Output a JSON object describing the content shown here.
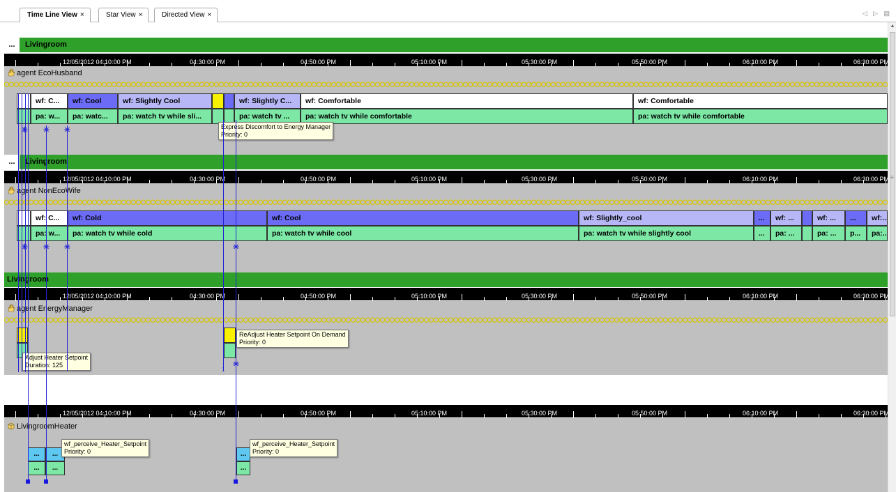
{
  "tabs": [
    {
      "label": "Time Line View",
      "close": "×",
      "active": true
    },
    {
      "label": "Star View",
      "close": "×",
      "active": false
    },
    {
      "label": "Directed View",
      "close": "×",
      "active": false
    }
  ],
  "tab_controls": "◁ ▷ ▤",
  "more_label": "...",
  "timeline": {
    "date_label": "12/05/2012 04:10:00 PM",
    "tick_labels": [
      "04:30:00 PM",
      "04:50:00 PM",
      "05:10:00 PM",
      "05:30:00 PM",
      "05:50:00 PM",
      "06:10:00 PM",
      "06:30:00 PM"
    ]
  },
  "panels": [
    {
      "room": "Livingroom",
      "agent": "agent EcoHusband"
    },
    {
      "room": "Livingroom",
      "agent": "agent NonEcoWife"
    },
    {
      "room": "Livingroom",
      "agent": "agent EnergyManager"
    },
    {
      "room": "",
      "agent": "LivingroomHeater"
    }
  ],
  "husband": {
    "wf": [
      "wf: C...",
      "wf: Cool",
      "wf: Slightly Cool",
      "wf: Slightly C...",
      "wf: Comfortable",
      "wf: Comfortable"
    ],
    "pa": [
      "pa: w...",
      "pa: watc...",
      "pa: watch tv while sli...",
      "pa: watch tv ...",
      "pa: watch tv while comfortable",
      "pa: watch tv while comfortable"
    ],
    "tooltip": [
      "Express Discomfort to Energy Manager",
      "Priority: 0"
    ]
  },
  "wife": {
    "wf": [
      "wf: C...",
      "wf: Cold",
      "wf: Cool",
      "wf: Slightly_cool",
      "...",
      "wf: ...",
      "...",
      "wf:..."
    ],
    "pa": [
      "pa: w...",
      "pa: watch tv while cold",
      "pa: watch tv while cool",
      "pa: watch tv while slightly cool",
      "...",
      "pa: ...",
      "pa: ...",
      "p...",
      "pa:..."
    ]
  },
  "manager": {
    "tooltip1": [
      "Adjust Heater Setpoint",
      "Duration: 125"
    ],
    "tooltip2": [
      "ReAdjust Heater Setpoint On Demand",
      "Priority: 0"
    ],
    "marker": "1"
  },
  "heater": {
    "tooltip1": [
      "wf_perceive_Heater_Setpoint",
      "Priority: 0"
    ],
    "tooltip2": [
      "wf_perceive_Heater_Setpoint",
      "Priority: 0"
    ],
    "cells": "..."
  },
  "colors": {
    "room_bar": "#2fa12a",
    "wf_blue": "#6b6bf5",
    "wf_light": "#b7b7f7",
    "pa_green": "#7de8a5",
    "event_yellow": "#f8f200",
    "link_blue": "#2323d6"
  }
}
